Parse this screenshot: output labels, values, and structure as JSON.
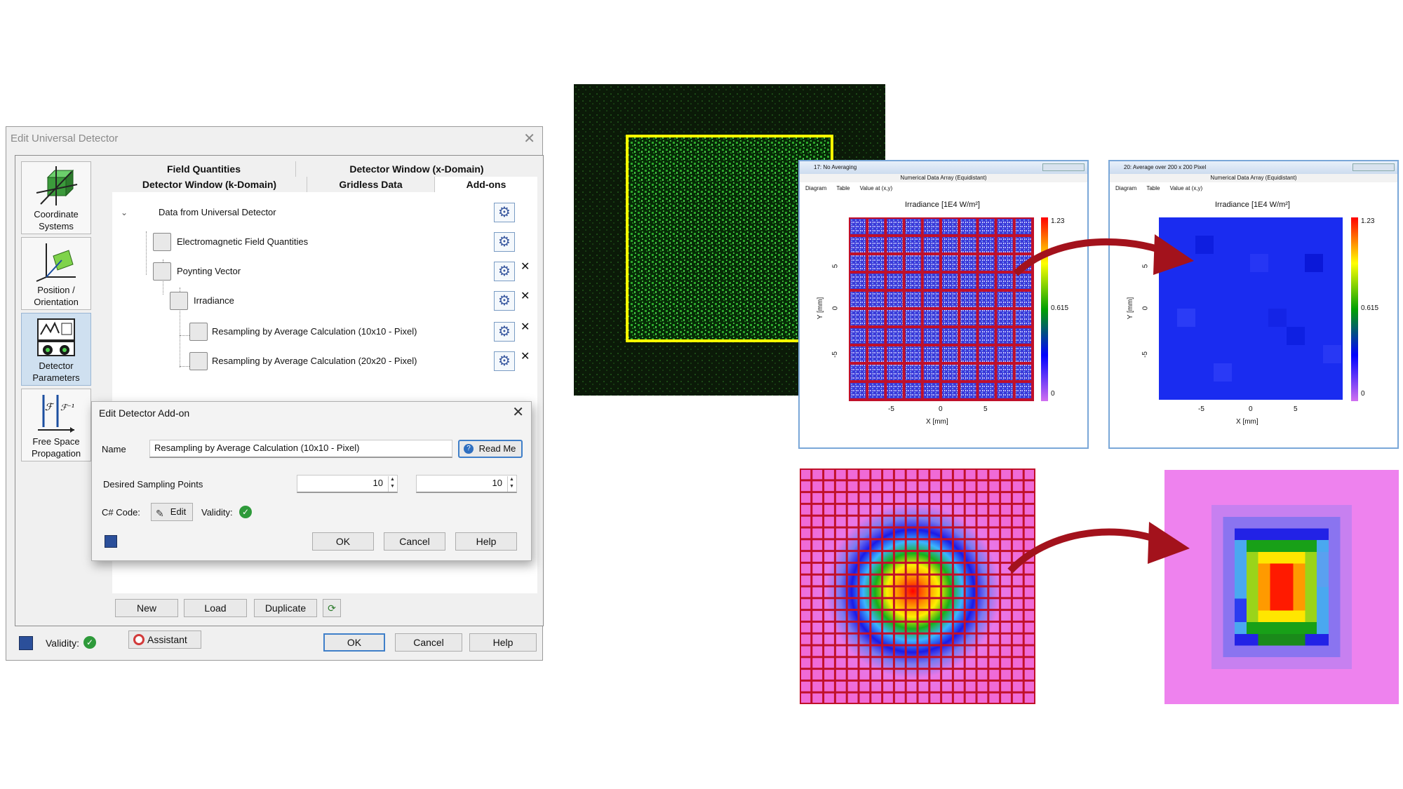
{
  "dialog": {
    "title": "Edit Universal Detector",
    "sidebar": [
      {
        "label1": "Coordinate",
        "label2": "Systems"
      },
      {
        "label1": "Position /",
        "label2": "Orientation"
      },
      {
        "label1": "Detector",
        "label2": "Parameters"
      },
      {
        "label1": "Free Space",
        "label2": "Propagation"
      }
    ],
    "tabs_row1": [
      "Field Quantities",
      "Detector Window (x-Domain)"
    ],
    "tabs_row2": [
      "Detector Window (k-Domain)",
      "Gridless Data",
      "Add-ons"
    ],
    "tree": [
      "Data from Universal Detector",
      "Electromagnetic Field Quantities",
      "Poynting Vector",
      "Irradiance",
      "Resampling by Average Calculation (10x10 - Pixel)",
      "Resampling by Average Calculation (20x20 - Pixel)"
    ],
    "bottom_buttons": {
      "new": "New",
      "load": "Load",
      "duplicate": "Duplicate"
    },
    "footer": {
      "validity": "Validity:",
      "assistant": "Assistant",
      "ok": "OK",
      "cancel": "Cancel",
      "help": "Help"
    }
  },
  "addon_dialog": {
    "title": "Edit Detector Add-on",
    "name_label": "Name",
    "name_value": "Resampling by Average Calculation (10x10 - Pixel)",
    "read_me": "Read Me",
    "sampling_label": "Desired Sampling Points",
    "sampling_x": "10",
    "sampling_y": "10",
    "code_label": "C# Code:",
    "edit": "Edit",
    "validity": "Validity:",
    "ok": "OK",
    "cancel": "Cancel",
    "help": "Help"
  },
  "plot_windows": [
    {
      "window_title": "17: No Averaging",
      "subtitle": "Numerical Data Array (Equidistant)",
      "tabs": [
        "Diagram",
        "Table",
        "Value at (x,y)"
      ],
      "plot_title": "Irradiance  [1E4 W/m²]",
      "xlabel": "X [mm]",
      "ylabel": "Y [mm]",
      "xticks": [
        "-5",
        "0",
        "5"
      ],
      "yticks": [
        "5",
        "0",
        "-5"
      ],
      "colorbar": [
        "1.23",
        "0.615",
        "0"
      ]
    },
    {
      "window_title": "20: Average over 200 x 200 Pixel",
      "subtitle": "Numerical Data Array (Equidistant)",
      "tabs": [
        "Diagram",
        "Table",
        "Value at (x,y)"
      ],
      "plot_title": "Irradiance  [1E4 W/m²]",
      "xlabel": "X [mm]",
      "ylabel": "Y [mm]",
      "xticks": [
        "-5",
        "0",
        "5"
      ],
      "yticks": [
        "5",
        "0",
        "-5"
      ],
      "colorbar": [
        "1.23",
        "0.615",
        "0"
      ]
    }
  ],
  "colors": {
    "accent": "#3f7fc9",
    "arrow": "#a3121c",
    "grid_overlay": "#c0102a",
    "speckle_bg": "#0b1a08",
    "speckle_box": "#ffff00"
  }
}
